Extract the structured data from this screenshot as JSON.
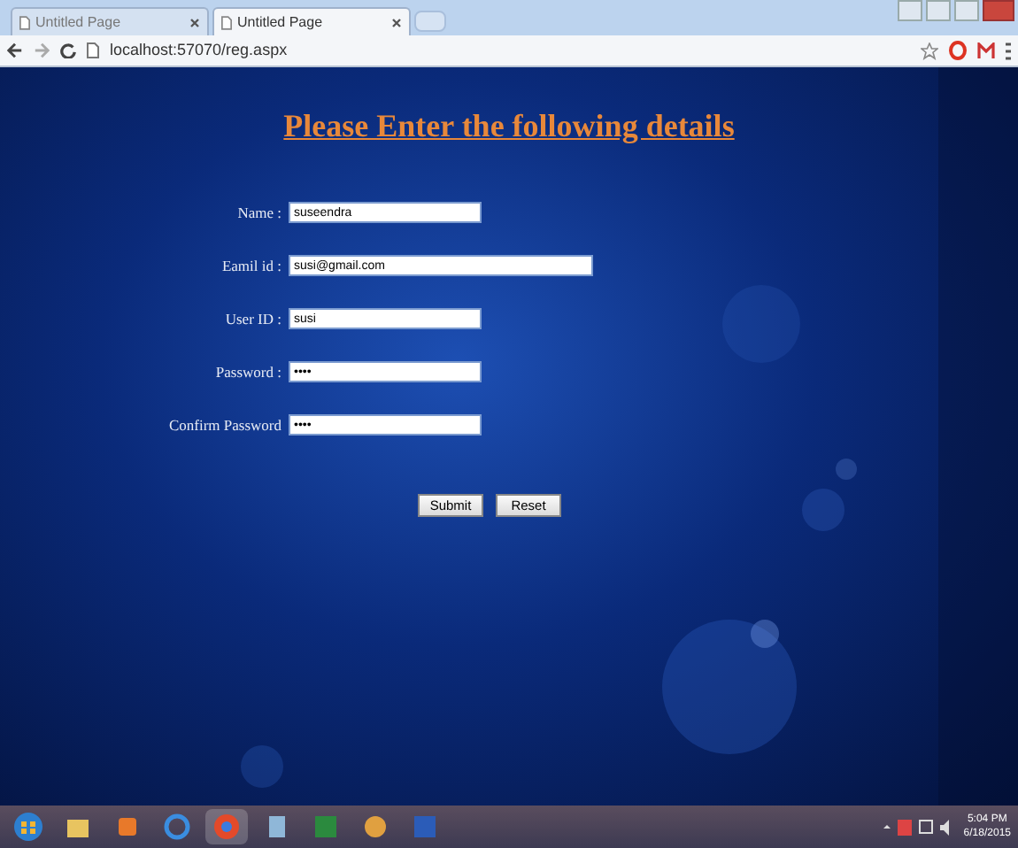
{
  "browser": {
    "tabs": [
      {
        "title": "Untitled Page",
        "selected": false
      },
      {
        "title": "Untitled Page",
        "selected": true
      }
    ],
    "address": "localhost:57070/reg.aspx"
  },
  "page": {
    "heading": "Please Enter the following details",
    "fields": [
      {
        "label": "Name :",
        "value": "suseendra",
        "wide": false
      },
      {
        "label": "Eamil id :",
        "value": "susi@gmail.com",
        "wide": true
      },
      {
        "label": "User ID :",
        "value": "susi",
        "wide": false
      },
      {
        "label": "Password :",
        "value": "••••",
        "wide": false
      },
      {
        "label": "Confirm Password",
        "value": "••••",
        "wide": false
      }
    ],
    "buttons": [
      "Submit",
      "Reset"
    ]
  },
  "taskbar": {
    "time": "5:04 PM",
    "date": "6/18/2015"
  }
}
